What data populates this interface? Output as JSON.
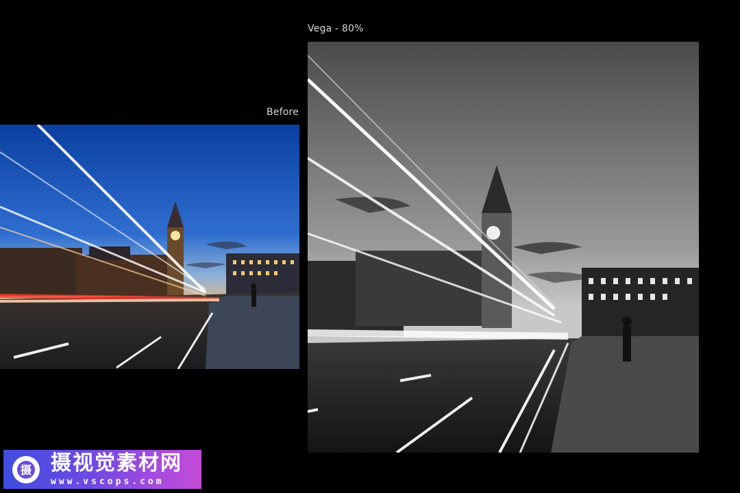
{
  "labels": {
    "before": "Before",
    "after": "Vega - 80%"
  },
  "watermark": {
    "title": "摄视觉素材网",
    "url": "www.vscops.com",
    "logo_glyph": "摄"
  },
  "colors": {
    "background": "#000000",
    "label_text": "#d9d9d9",
    "watermark_gradient_start": "#3f4de0",
    "watermark_gradient_end": "#c34bd6"
  }
}
